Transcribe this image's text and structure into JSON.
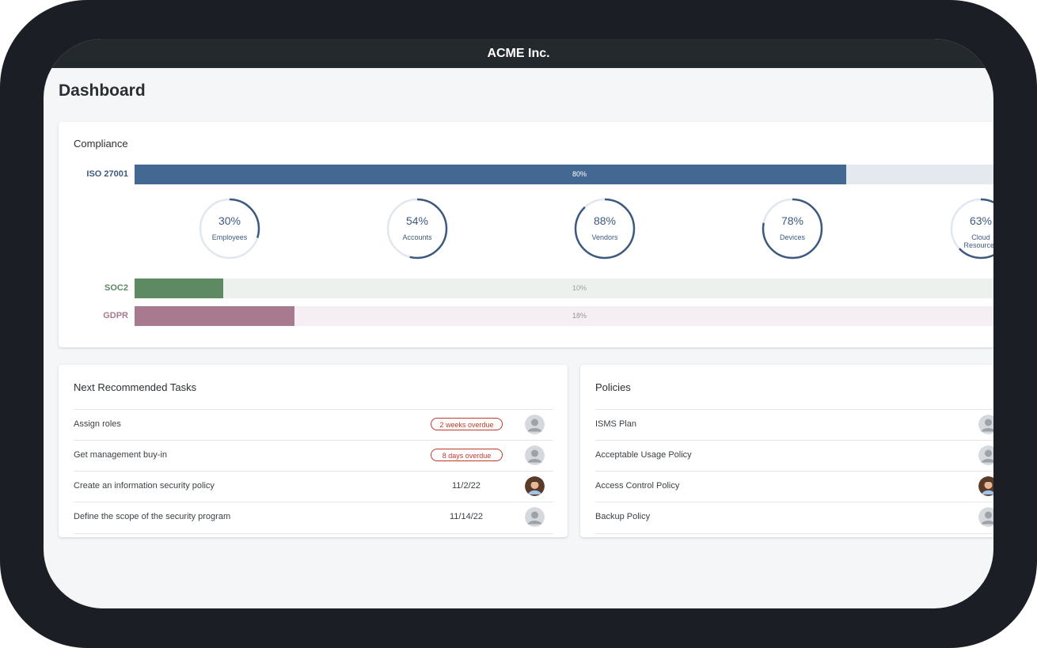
{
  "app": {
    "title": "ACME Inc."
  },
  "page": {
    "title": "Dashboard"
  },
  "compliance": {
    "title": "Compliance",
    "frameworks": [
      {
        "name": "ISO 27001",
        "percent": 80,
        "label": "80%",
        "color": "#436891",
        "track": "#e4e9ef",
        "label_color": "#3d5a7e",
        "text_color": "#ffffff"
      },
      {
        "name": "SOC2",
        "percent": 10,
        "label": "10%",
        "color": "#5d8a63",
        "track": "#edf1ee",
        "label_color": "#5d8a63",
        "text_color": "#9aa19c"
      },
      {
        "name": "GDPR",
        "percent": 18,
        "label": "18%",
        "color": "#a77a90",
        "track": "#f5eff3",
        "label_color": "#a77a90",
        "text_color": "#9a9398"
      }
    ],
    "rings": [
      {
        "percent": 30,
        "label": "30%",
        "name": "Employees"
      },
      {
        "percent": 54,
        "label": "54%",
        "name": "Accounts"
      },
      {
        "percent": 88,
        "label": "88%",
        "name": "Vendors"
      },
      {
        "percent": 78,
        "label": "78%",
        "name": "Devices"
      },
      {
        "percent": 63,
        "label": "63%",
        "name": "Cloud Resources"
      }
    ]
  },
  "tasks": {
    "title": "Next Recommended Tasks",
    "items": [
      {
        "name": "Assign roles",
        "status": "2 weeks overdue",
        "avatar": "placeholder"
      },
      {
        "name": "Get management buy-in",
        "status": "8 days overdue",
        "avatar": "placeholder"
      },
      {
        "name": "Create an information security policy",
        "date": "11/2/22",
        "avatar": "photo"
      },
      {
        "name": "Define the scope of the security program",
        "date": "11/14/22",
        "avatar": "placeholder"
      }
    ]
  },
  "policies": {
    "title": "Policies",
    "items": [
      {
        "name": "ISMS Plan",
        "avatar": "placeholder"
      },
      {
        "name": "Acceptable Usage Policy",
        "avatar": "placeholder"
      },
      {
        "name": "Access Control Policy",
        "avatar": "photo"
      },
      {
        "name": "Backup Policy",
        "avatar": "placeholder"
      }
    ]
  }
}
